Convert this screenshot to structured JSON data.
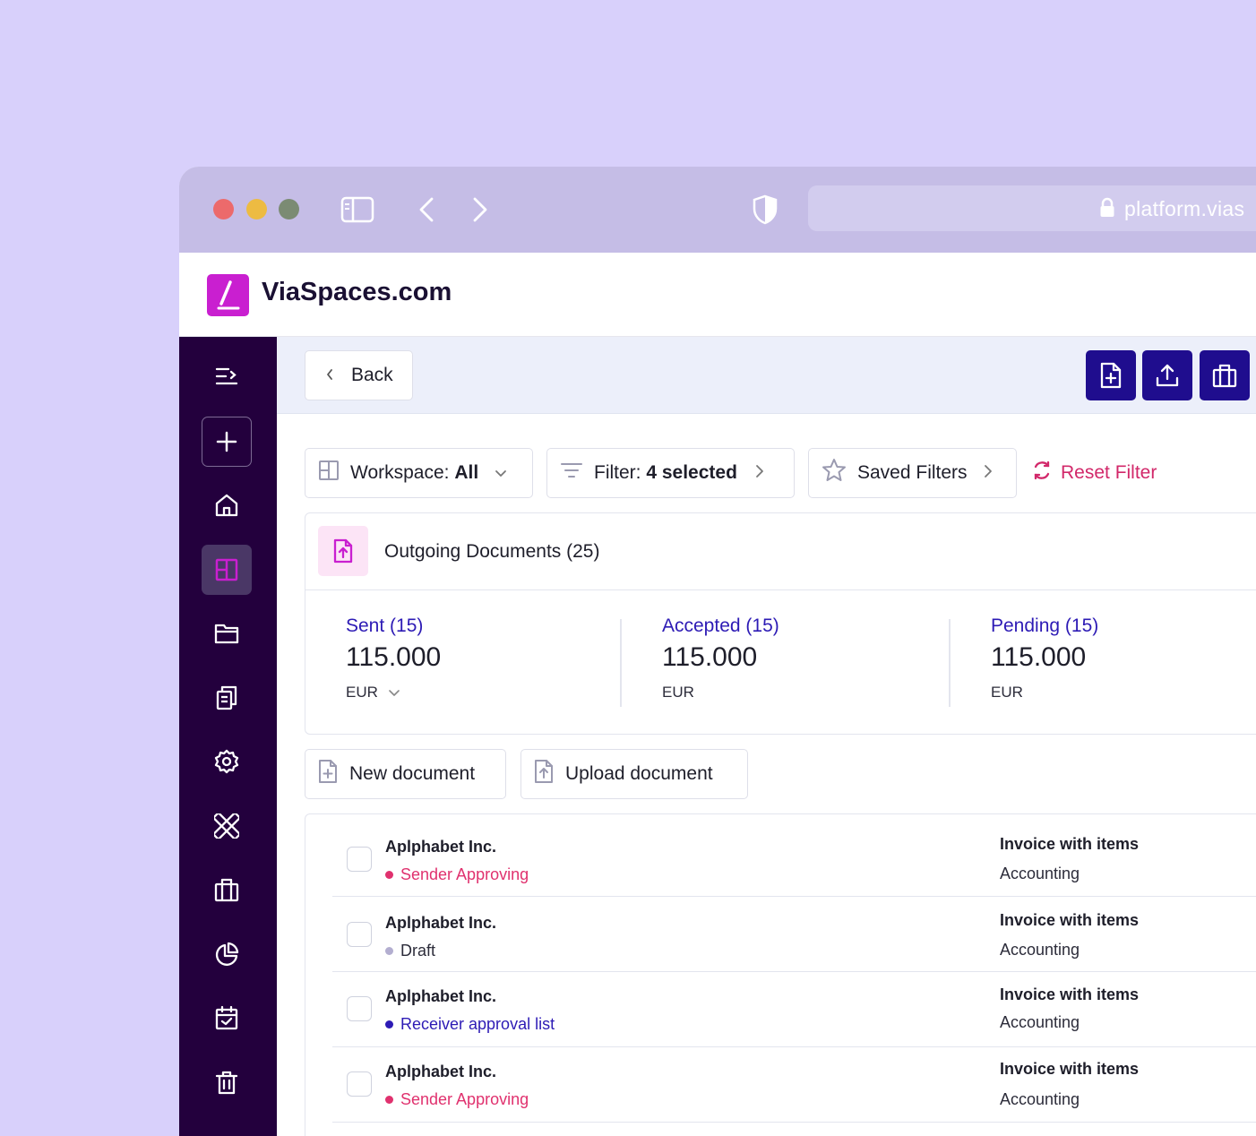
{
  "browser": {
    "url": "platform.vias",
    "icons": [
      "sidebar-toggle-icon",
      "back-arrow-icon",
      "forward-arrow-icon",
      "shield-icon",
      "lock-icon"
    ]
  },
  "app": {
    "brand": "ViaSpaces.com",
    "logo_color": "#c91fd0"
  },
  "sidebar": {
    "items": [
      {
        "name": "menu-collapse-icon"
      },
      {
        "name": "add-icon"
      },
      {
        "name": "home-icon"
      },
      {
        "name": "workspace-icon",
        "active": true
      },
      {
        "name": "folder-icon"
      },
      {
        "name": "documents-icon"
      },
      {
        "name": "settings-icon"
      },
      {
        "name": "tools-icon"
      },
      {
        "name": "briefcase-icon"
      },
      {
        "name": "pie-chart-icon"
      },
      {
        "name": "calendar-check-icon"
      },
      {
        "name": "trash-icon"
      }
    ],
    "active_color": "#c91fd0"
  },
  "toolbar": {
    "back_label": "Back",
    "action_icons": [
      "new-file-icon",
      "upload-icon",
      "briefcase-icon"
    ],
    "action_color": "#1f0d8e"
  },
  "filters": {
    "workspace_prefix": "Workspace:",
    "workspace_value": "All",
    "filter_prefix": "Filter:",
    "filter_value": "4 selected",
    "saved_filters": "Saved Filters",
    "reset_filter": "Reset Filter"
  },
  "summary": {
    "title": "Outgoing Documents (25)",
    "stats": [
      {
        "label": "Sent (15)",
        "value": "115.000",
        "currency": "EUR",
        "has_dropdown": true
      },
      {
        "label": "Accepted (15)",
        "value": "115.000",
        "currency": "EUR",
        "has_dropdown": false
      },
      {
        "label": "Pending (15)",
        "value": "115.000",
        "currency": "EUR",
        "has_dropdown": false
      }
    ],
    "label_color": "#2d1bb5"
  },
  "actions": {
    "new_document": "New document",
    "upload_document": "Upload document"
  },
  "documents": [
    {
      "name": "Aplphabet Inc.",
      "status": "Sender Approving",
      "status_color": "#e0316e",
      "type": "Invoice with items",
      "category": "Accounting"
    },
    {
      "name": "Aplphabet Inc.",
      "status": "Draft",
      "status_color": "#b3aed0",
      "type": "Invoice with items",
      "category": "Accounting"
    },
    {
      "name": "Aplphabet Inc.",
      "status": "Receiver approval list",
      "status_color": "#2d1bb5",
      "type": "Invoice with items",
      "category": "Accounting"
    },
    {
      "name": "Aplphabet Inc.",
      "status": "Sender Approving",
      "status_color": "#e0316e",
      "type": "Invoice with items",
      "category": "Accounting"
    }
  ]
}
